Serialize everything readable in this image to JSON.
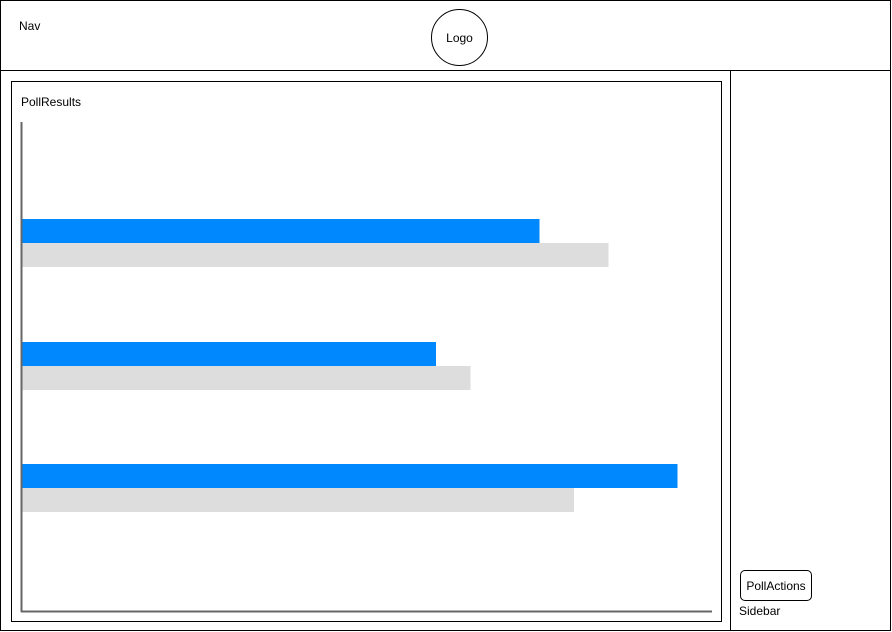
{
  "nav": {
    "label": "Nav"
  },
  "logo": {
    "label": "Logo"
  },
  "poll_results": {
    "label": "PollResults"
  },
  "sidebar": {
    "label": "Sidebar",
    "poll_actions_label": "PollActions"
  },
  "colors": {
    "primary_bar": "#0088ff",
    "secondary_bar": "#dddddd",
    "axis": "#666666"
  },
  "chart_data": {
    "type": "bar",
    "orientation": "horizontal",
    "title": "",
    "xlabel": "",
    "ylabel": "",
    "xlim": [
      0,
      100
    ],
    "grid": false,
    "series": [
      {
        "values": [
          75,
          60,
          95
        ],
        "color": "#0088ff"
      },
      {
        "values": [
          85,
          65,
          80
        ],
        "color": "#dddddd"
      }
    ]
  }
}
